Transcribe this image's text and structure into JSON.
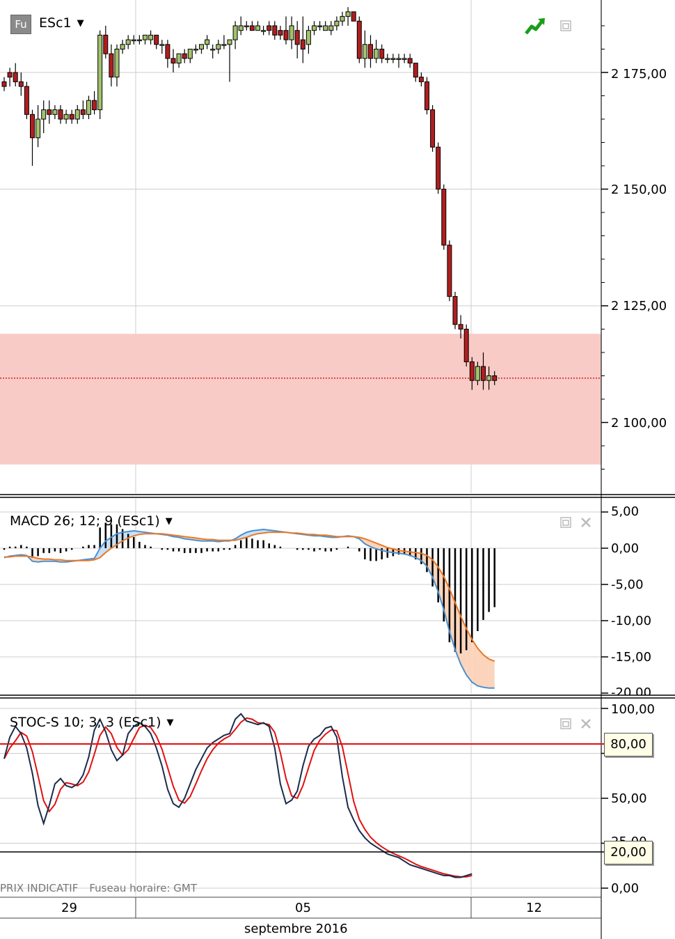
{
  "main_pane": {
    "logo_text": "Fu",
    "symbol": "ESc1",
    "y_ticks": [
      "2 175,00",
      "2 150,00",
      "2 125,00",
      "2 100,00"
    ]
  },
  "macd_pane": {
    "title": "MACD 26; 12; 9 (ESc1)",
    "y_ticks": [
      "5,00",
      "0,00",
      "-5,00",
      "-10,00",
      "-15,00",
      "-20,00"
    ]
  },
  "stoch_pane": {
    "title": "STOC-S 10; 3; 3 (ESc1)",
    "y_ticks": [
      "100,00",
      "50,00",
      "0,00",
      "25,00"
    ],
    "overbought_label": "80,00",
    "oversold_label": "20,00"
  },
  "footer": {
    "price_note": "PRIX INDICATIF",
    "timezone_note": "Fuseau horaire: GMT"
  },
  "x_axis": {
    "labels": [
      "29",
      "05",
      "12"
    ],
    "month_label": "septembre 2016"
  },
  "colors": {
    "up_candle": "#a3c26b",
    "down_candle": "#b01e1e",
    "highlight_band": "#f8cbc7",
    "macd_line": "#4a90d0",
    "signal_line": "#e8792a",
    "stoch_k": "#1a2b4a",
    "stoch_d": "#e01010",
    "grid": "#cccccc"
  },
  "chart_data": [
    {
      "type": "candlestick",
      "symbol": "ESc1",
      "y_range": [
        2089,
        2190
      ],
      "highlight_band": [
        2091,
        2119
      ],
      "current_price": 2109.5,
      "candles": [
        [
          2173,
          2174,
          2171,
          2172
        ],
        [
          2175,
          2176,
          2172,
          2174
        ],
        [
          2175,
          2177,
          2172,
          2173
        ],
        [
          2173,
          2175,
          2170,
          2172
        ],
        [
          2172,
          2173,
          2165,
          2166
        ],
        [
          2166,
          2167,
          2155,
          2161
        ],
        [
          2161,
          2168,
          2159,
          2165
        ],
        [
          2165,
          2169,
          2162,
          2167
        ],
        [
          2167,
          2169,
          2164,
          2166
        ],
        [
          2166,
          2168,
          2165,
          2167
        ],
        [
          2167,
          2168,
          2164,
          2165
        ],
        [
          2165,
          2167,
          2164,
          2166
        ],
        [
          2166,
          2167,
          2164,
          2165
        ],
        [
          2165,
          2168,
          2164,
          2167
        ],
        [
          2167,
          2169,
          2165,
          2166
        ],
        [
          2166,
          2170,
          2165,
          2169
        ],
        [
          2169,
          2171,
          2166,
          2167
        ],
        [
          2167,
          2184,
          2165,
          2183
        ],
        [
          2183,
          2185,
          2178,
          2179
        ],
        [
          2179,
          2181,
          2172,
          2174
        ],
        [
          2174,
          2181,
          2172,
          2180
        ],
        [
          2180,
          2182,
          2179,
          2181
        ],
        [
          2181,
          2183,
          2180,
          2182
        ],
        [
          2182,
          2183,
          2181,
          2182
        ],
        [
          2182,
          2183,
          2181,
          2182
        ],
        [
          2182,
          2183,
          2181,
          2183
        ],
        [
          2182,
          2184,
          2181,
          2183
        ],
        [
          2183,
          2183,
          2180,
          2181
        ],
        [
          2181,
          2182,
          2179,
          2181
        ],
        [
          2181,
          2182,
          2176,
          2178
        ],
        [
          2178,
          2180,
          2175,
          2177
        ],
        [
          2177,
          2179,
          2176,
          2179
        ],
        [
          2179,
          2180,
          2177,
          2178
        ],
        [
          2178,
          2180,
          2177,
          2180
        ],
        [
          2180,
          2181,
          2179,
          2180
        ],
        [
          2180,
          2181,
          2179,
          2181
        ],
        [
          2181,
          2183,
          2180,
          2182
        ],
        [
          2180,
          2181,
          2178,
          2180
        ],
        [
          2180,
          2182,
          2179,
          2181
        ],
        [
          2181,
          2183,
          2180,
          2181
        ],
        [
          2181,
          2182,
          2173,
          2182
        ],
        [
          2182,
          2186,
          2180,
          2185
        ],
        [
          2184,
          2187,
          2183,
          2185
        ],
        [
          2185,
          2186,
          2184,
          2185
        ],
        [
          2185,
          2186,
          2184,
          2184
        ],
        [
          2184,
          2186,
          2184,
          2185
        ],
        [
          2184,
          2185,
          2183,
          2184
        ],
        [
          2185,
          2186,
          2183,
          2184
        ],
        [
          2185,
          2186,
          2182,
          2183
        ],
        [
          2184,
          2185,
          2182,
          2183
        ],
        [
          2184,
          2187,
          2181,
          2182
        ],
        [
          2182,
          2187,
          2180,
          2185
        ],
        [
          2184,
          2186,
          2178,
          2181
        ],
        [
          2182,
          2187,
          2177,
          2180
        ],
        [
          2181,
          2185,
          2179,
          2184
        ],
        [
          2184,
          2186,
          2183,
          2185
        ],
        [
          2185,
          2186,
          2184,
          2185
        ],
        [
          2184,
          2186,
          2184,
          2185
        ],
        [
          2184,
          2186,
          2183,
          2185
        ],
        [
          2185,
          2187,
          2184,
          2186
        ],
        [
          2186,
          2188,
          2185,
          2187
        ],
        [
          2187,
          2189,
          2185,
          2188
        ],
        [
          2188,
          2188,
          2186,
          2186
        ],
        [
          2186,
          2187,
          2177,
          2178
        ],
        [
          2178,
          2184,
          2176,
          2181
        ],
        [
          2181,
          2183,
          2176,
          2178
        ],
        [
          2178,
          2182,
          2177,
          2180
        ],
        [
          2180,
          2181,
          2177,
          2178
        ],
        [
          2178,
          2179,
          2177,
          2178
        ],
        [
          2178,
          2179,
          2177,
          2178
        ],
        [
          2178,
          2179,
          2176,
          2178
        ],
        [
          2178,
          2179,
          2177,
          2178
        ],
        [
          2178,
          2179,
          2176,
          2177
        ],
        [
          2177,
          2177,
          2173,
          2174
        ],
        [
          2174,
          2175,
          2172,
          2173
        ],
        [
          2173,
          2174,
          2166,
          2167
        ],
        [
          2167,
          2168,
          2158,
          2159
        ],
        [
          2159,
          2160,
          2149,
          2150
        ],
        [
          2150,
          2151,
          2137,
          2138
        ],
        [
          2138,
          2139,
          2126,
          2127
        ],
        [
          2127,
          2128,
          2120,
          2121
        ],
        [
          2121,
          2123,
          2118,
          2120
        ],
        [
          2120,
          2121,
          2112,
          2113
        ],
        [
          2113,
          2114,
          2107,
          2109
        ],
        [
          2109,
          2113,
          2108,
          2112
        ],
        [
          2112,
          2115,
          2107,
          2109
        ],
        [
          2109,
          2112,
          2107,
          2110
        ],
        [
          2110,
          2111,
          2108,
          2109
        ]
      ]
    },
    {
      "type": "macd",
      "params": [
        26,
        12,
        9
      ],
      "y_range": [
        -20,
        5
      ],
      "macd": [
        -1.3,
        -1.1,
        -1.0,
        -0.9,
        -1.0,
        -1.8,
        -1.9,
        -1.8,
        -1.8,
        -1.8,
        -1.9,
        -1.9,
        -1.8,
        -1.7,
        -1.6,
        -1.5,
        -1.4,
        0.0,
        1.0,
        1.5,
        2.0,
        2.2,
        2.3,
        2.4,
        2.3,
        2.2,
        2.1,
        2.0,
        1.9,
        1.8,
        1.6,
        1.5,
        1.3,
        1.2,
        1.1,
        1.0,
        1.0,
        1.0,
        0.9,
        1.0,
        1.0,
        1.3,
        1.8,
        2.2,
        2.4,
        2.5,
        2.6,
        2.5,
        2.4,
        2.3,
        2.2,
        2.1,
        2.0,
        1.9,
        1.8,
        1.7,
        1.7,
        1.6,
        1.5,
        1.5,
        1.6,
        1.7,
        1.6,
        1.3,
        0.6,
        0.2,
        -0.1,
        -0.3,
        -0.5,
        -0.6,
        -0.7,
        -0.8,
        -1.0,
        -1.3,
        -1.7,
        -2.5,
        -4.0,
        -6.0,
        -8.5,
        -11.5,
        -14.0,
        -16.0,
        -17.5,
        -18.5,
        -19.0,
        -19.2,
        -19.3,
        -19.3
      ],
      "signal": [
        -1.2,
        -1.2,
        -1.1,
        -1.1,
        -1.1,
        -1.2,
        -1.4,
        -1.5,
        -1.5,
        -1.6,
        -1.6,
        -1.7,
        -1.7,
        -1.7,
        -1.7,
        -1.7,
        -1.6,
        -1.3,
        -0.6,
        0.0,
        0.5,
        1.0,
        1.4,
        1.7,
        1.9,
        2.0,
        2.0,
        2.0,
        2.0,
        1.9,
        1.8,
        1.7,
        1.6,
        1.5,
        1.4,
        1.3,
        1.2,
        1.2,
        1.1,
        1.1,
        1.1,
        1.1,
        1.3,
        1.5,
        1.8,
        2.0,
        2.1,
        2.2,
        2.2,
        2.2,
        2.2,
        2.1,
        2.1,
        2.0,
        1.9,
        1.9,
        1.8,
        1.8,
        1.7,
        1.6,
        1.6,
        1.6,
        1.6,
        1.5,
        1.3,
        1.0,
        0.7,
        0.4,
        0.1,
        -0.1,
        -0.3,
        -0.4,
        -0.5,
        -0.6,
        -0.7,
        -1.0,
        -1.6,
        -2.6,
        -3.9,
        -5.6,
        -7.5,
        -9.4,
        -11.1,
        -12.6,
        -13.8,
        -14.7,
        -15.3,
        -15.6
      ]
    },
    {
      "type": "stochastic",
      "params": [
        10,
        3,
        3
      ],
      "y_range": [
        0,
        100
      ],
      "overbought": 80,
      "oversold": 20,
      "k": [
        72,
        84,
        90,
        86,
        78,
        64,
        46,
        36,
        46,
        58,
        61,
        57,
        56,
        58,
        63,
        73,
        88,
        94,
        87,
        77,
        71,
        74,
        86,
        90,
        92,
        90,
        86,
        78,
        68,
        55,
        47,
        45,
        50,
        58,
        66,
        72,
        78,
        81,
        83,
        85,
        86,
        94,
        97,
        93,
        92,
        91,
        92,
        90,
        78,
        58,
        47,
        49,
        54,
        68,
        79,
        83,
        85,
        89,
        90,
        84,
        62,
        45,
        38,
        32,
        28,
        25,
        23,
        21,
        19,
        18,
        17,
        15,
        13,
        12,
        11,
        10,
        9,
        8,
        7,
        7,
        6,
        6,
        7,
        8
      ]
    }
  ]
}
